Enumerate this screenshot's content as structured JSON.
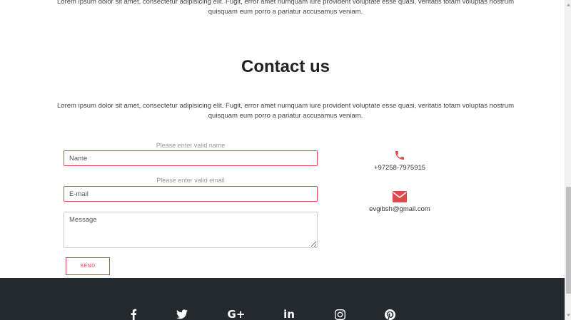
{
  "about": {
    "text": "Lorem ipsum dolor sit amet, consectetur adipisicing elit. Fugit, error amet numquam iure provident voluptate esse quasi, veritatis totam voluptas nostrum quisquam eum porro a pariatur accusamus veniam."
  },
  "contact": {
    "title": "Contact us",
    "lead": "Lorem ipsum dolor sit amet, consectetur adipisicing elit. Fugit, error amet numquam iure provident voluptate esse quasi, veritatis totam voluptas nostrum quisquam eum porro a pariatur accusamus veniam.",
    "form": {
      "name_hint": "Please enter valid name",
      "name_placeholder": "Name",
      "email_hint": "Please enter valid email",
      "email_placeholder": "E-mail",
      "message_placeholder": "Message",
      "send_label": "SEND"
    },
    "info": {
      "phone": "+97258-7975915",
      "email": "evgibsh@gmail.com"
    },
    "colors": {
      "accent": "#e0484b",
      "footer_bg": "#23292f"
    }
  },
  "footer": {
    "social": [
      {
        "icon": "facebook-icon",
        "glyph": "f"
      },
      {
        "icon": "twitter-icon",
        "glyph": ""
      },
      {
        "icon": "google-plus-icon",
        "glyph": "G+"
      },
      {
        "icon": "linkedin-icon",
        "glyph": "in"
      },
      {
        "icon": "instagram-icon",
        "glyph": ""
      },
      {
        "icon": "pinterest-icon",
        "glyph": ""
      }
    ]
  }
}
